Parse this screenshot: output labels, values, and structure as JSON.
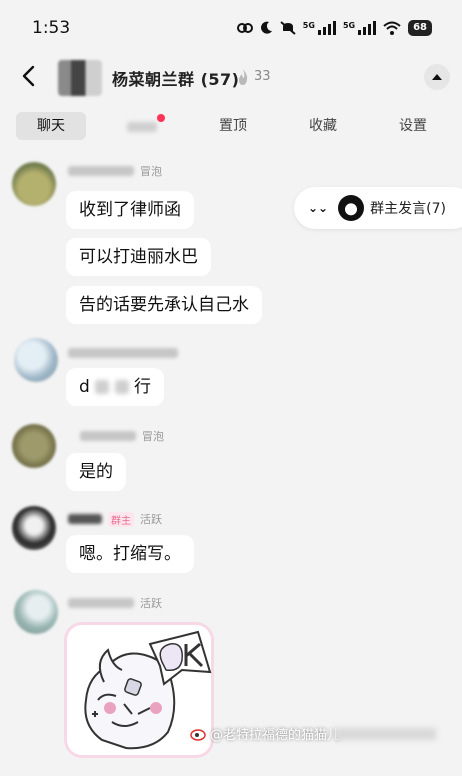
{
  "status_bar": {
    "time": "1:53",
    "network_1": "5G",
    "network_2": "5G",
    "battery": "68"
  },
  "header": {
    "title": "杨菜朝兰群 (57)",
    "likes": "33"
  },
  "tabs": [
    {
      "label": "聊天"
    },
    {
      "label": "置顶"
    },
    {
      "label": "收藏"
    },
    {
      "label": "设置"
    }
  ],
  "owner_speech": {
    "label": "群主发言(7)"
  },
  "messages": [
    {
      "tag": "冒泡",
      "bubbles": [
        "收到了律师函",
        "可以打迪丽水巴",
        "告的话要先承认自己水"
      ]
    },
    {
      "tag": "",
      "bubbles": [
        "d",
        "行"
      ]
    },
    {
      "tag": "冒泡",
      "bubbles": [
        "是的"
      ]
    },
    {
      "badge": "群主",
      "tag": "活跃",
      "bubbles": [
        "嗯。打缩写。"
      ]
    },
    {
      "tag": "活跃",
      "sticker": "OK"
    }
  ],
  "watermark": "@老特拉福德的猫猫儿",
  "colors": {
    "background": "#f3f3f3",
    "bubble": "#ffffff",
    "unread_dot": "#ff3355",
    "owner_badge": "#e96a8f"
  }
}
